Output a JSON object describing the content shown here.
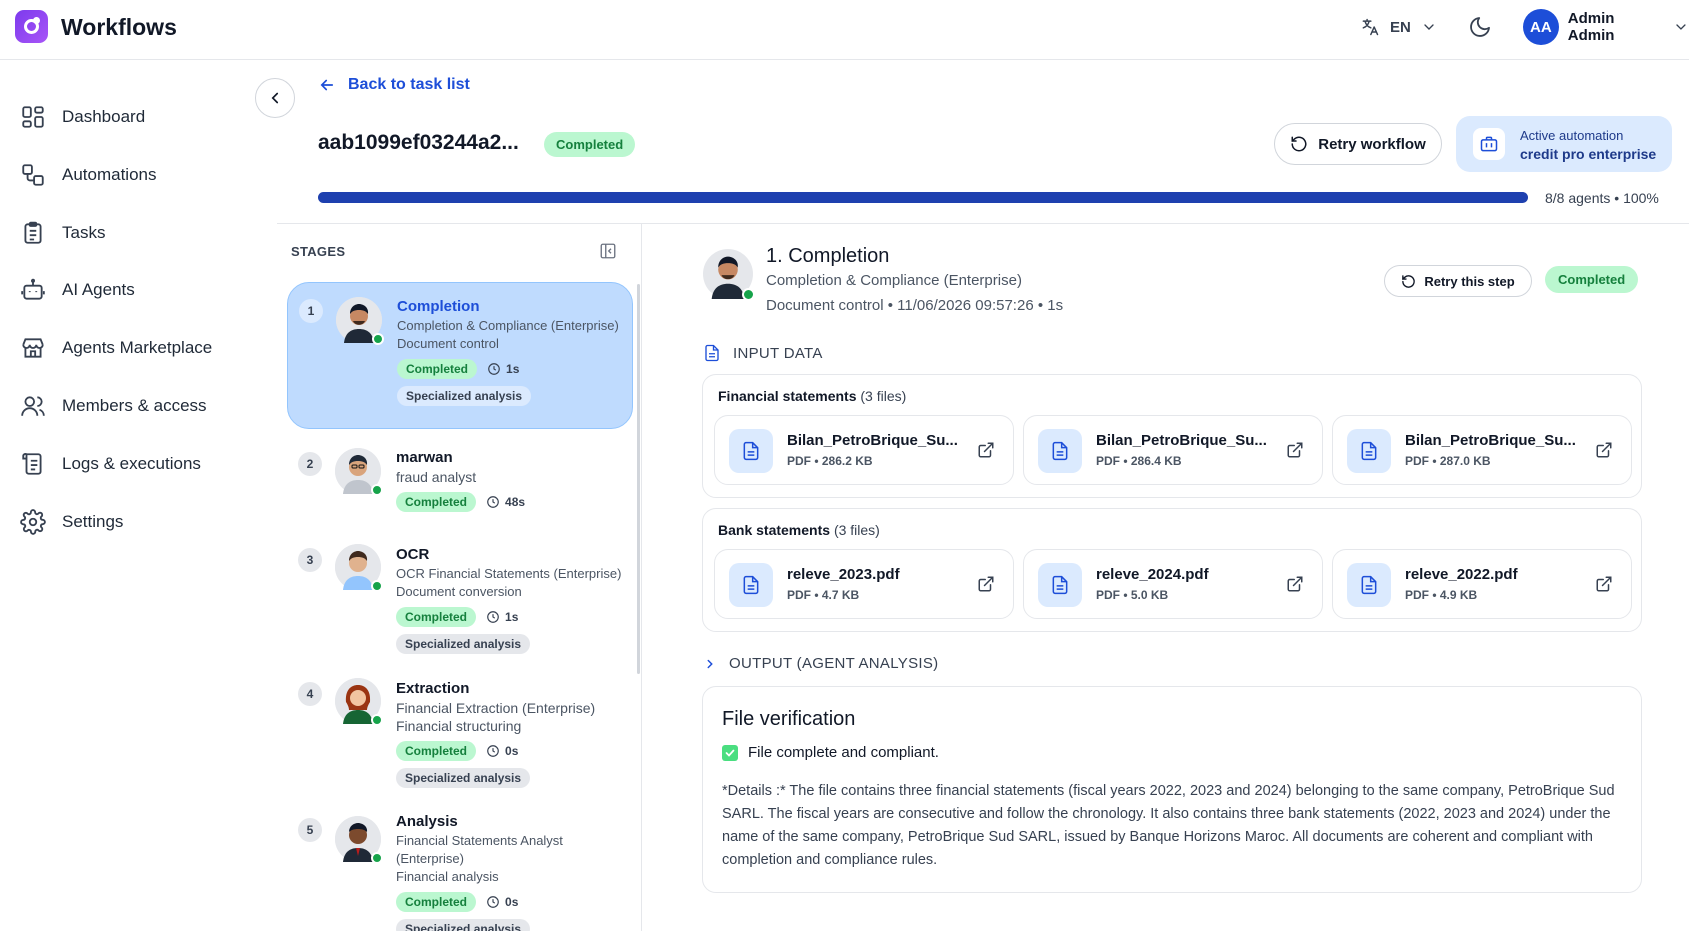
{
  "app": {
    "title": "Workflows"
  },
  "header": {
    "language": "EN",
    "user_initials": "AA",
    "user_name": "Admin Admin"
  },
  "sidebar": {
    "items": [
      {
        "label": "Dashboard"
      },
      {
        "label": "Automations"
      },
      {
        "label": "Tasks"
      },
      {
        "label": "AI Agents"
      },
      {
        "label": "Agents Marketplace"
      },
      {
        "label": "Members & access"
      },
      {
        "label": "Logs & executions"
      },
      {
        "label": "Settings"
      }
    ]
  },
  "task": {
    "back_label": "Back to task list",
    "id": "aab1099ef03244a2...",
    "status": "Completed",
    "retry_label": "Retry workflow",
    "automation_label": "Active automation",
    "automation_name": "credit pro enterprise",
    "progress_percent": 100,
    "progress_label": "8/8 agents • 100%"
  },
  "stages": {
    "title": "STAGES",
    "items": [
      {
        "num": "1",
        "name": "Completion",
        "sub1": "Completion & Compliance (Enterprise)",
        "sub2": "Document control",
        "status": "Completed",
        "duration": "1s",
        "tag": "Specialized analysis"
      },
      {
        "num": "2",
        "name": "marwan",
        "sub1": "fraud analyst",
        "status": "Completed",
        "duration": "48s"
      },
      {
        "num": "3",
        "name": "OCR",
        "sub1": "OCR Financial Statements (Enterprise)",
        "sub2": "Document conversion",
        "status": "Completed",
        "duration": "1s",
        "tag": "Specialized analysis"
      },
      {
        "num": "4",
        "name": "Extraction",
        "sub1": "Financial Extraction (Enterprise)",
        "sub2": "Financial structuring",
        "status": "Completed",
        "duration": "0s",
        "tag": "Specialized analysis"
      },
      {
        "num": "5",
        "name": "Analysis",
        "sub1": "Financial Statements Analyst (Enterprise)",
        "sub2": "Financial analysis",
        "status": "Completed",
        "duration": "0s",
        "tag": "Specialized analysis"
      }
    ]
  },
  "detail": {
    "title": "1. Completion",
    "subtitle": "Completion & Compliance (Enterprise)",
    "meta": "Document control • 11/06/2026 09:57:26 • 1s",
    "retry_label": "Retry this step",
    "status": "Completed",
    "input_header": "INPUT DATA",
    "groups": [
      {
        "title": "Financial statements",
        "count": "(3 files)",
        "files": [
          {
            "name": "Bilan_PetroBrique_Su...",
            "meta": "PDF • 286.2 KB"
          },
          {
            "name": "Bilan_PetroBrique_Su...",
            "meta": "PDF • 286.4 KB"
          },
          {
            "name": "Bilan_PetroBrique_Su...",
            "meta": "PDF • 287.0 KB"
          }
        ]
      },
      {
        "title": "Bank statements",
        "count": "(3 files)",
        "files": [
          {
            "name": "releve_2023.pdf",
            "meta": "PDF • 4.7 KB"
          },
          {
            "name": "releve_2024.pdf",
            "meta": "PDF • 5.0 KB"
          },
          {
            "name": "releve_2022.pdf",
            "meta": "PDF • 4.9 KB"
          }
        ]
      }
    ],
    "output_header": "OUTPUT (AGENT ANALYSIS)",
    "output": {
      "title": "File verification",
      "check": "File complete and compliant.",
      "details": "*Details :* The file contains three financial statements (fiscal years 2022, 2023 and 2024) belonging to the same company, PetroBrique Sud SARL. The fiscal years are consecutive and follow the chronology. It also contains three bank statements (2022, 2023 and 2024) under the name of the same company, PetroBrique Sud SARL, issued by Banque Horizons Maroc. All documents are coherent and compliant with completion and compliance rules."
    }
  },
  "colors": {
    "accent": "#1d4ed8",
    "success_bg": "#bbf7d0",
    "success_text": "#15803d",
    "brand": "#7c3aed"
  }
}
